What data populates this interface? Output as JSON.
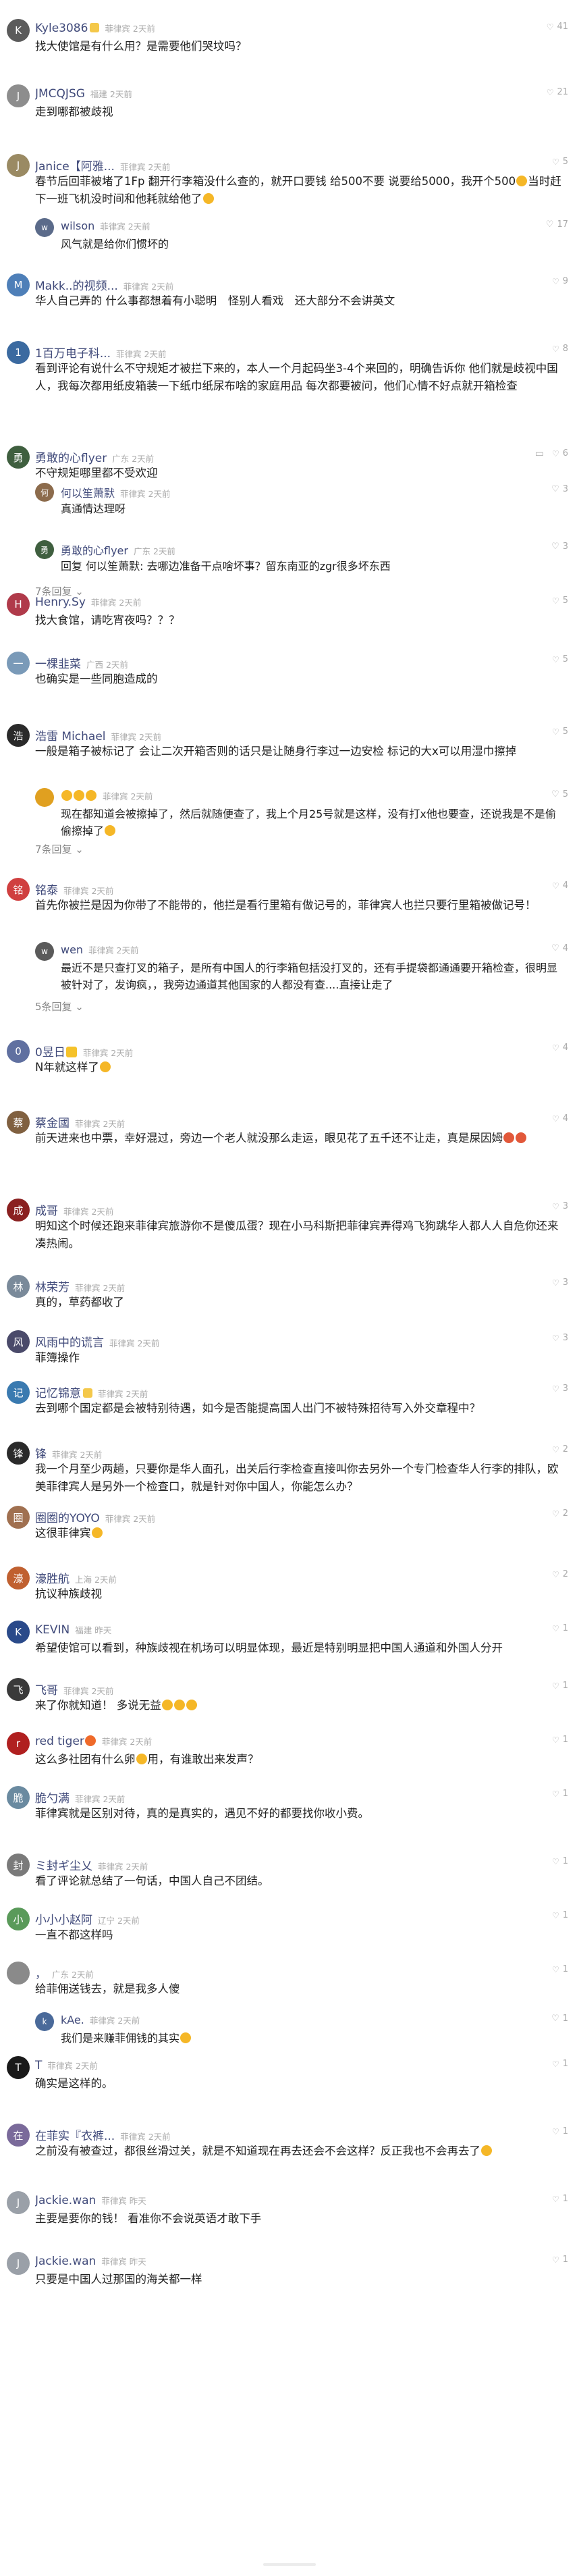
{
  "comments": [
    {
      "name": "Kyle3086",
      "badge": true,
      "meta": "菲律宾 2天前",
      "likes": "41",
      "text": "找大使馆是有什么用？是需要他们哭坟吗？",
      "color": "#5b5b5b",
      "replies": [],
      "more": ""
    },
    {
      "name": "JMCQJSG",
      "meta": "福建 2天前",
      "likes": "21",
      "text": "走到哪都被歧视",
      "color": "#8d8d8d",
      "replies": [],
      "more": ""
    },
    {
      "name": "Janice【阿雅...",
      "meta": "菲律宾 2天前",
      "likes": "5",
      "text": "春节后回菲被堵了1Fp 翻开行李箱没什么查的，就开口要钱 给500不要 说要给5000，我开个500😂当时赶下一班飞机没时间和他耗就给他了😂",
      "color": "#9a8a63",
      "replies": [
        {
          "name": "wilson",
          "meta": "菲律宾 2天前",
          "likes": "17",
          "text": "风气就是给你们惯坏的",
          "color": "#5b6b8a"
        }
      ],
      "more": ""
    },
    {
      "name": "Makk..的视频...",
      "meta": "菲律宾 2天前",
      "likes": "9",
      "text": "华人自己弄的 什么事都想着有小聪明　怪别人看戏　还大部分不会讲英文",
      "color": "#4e7fb8",
      "replies": [],
      "more": ""
    },
    {
      "name": "1百万电子科...",
      "meta": "菲律宾 2天前",
      "likes": "8",
      "text": "看到评论有说什么不守规矩才被拦下来的，本人一个月起码坐3-4个来回的，明确告诉你 他们就是歧视中国人，我每次都用纸皮箱装一下纸巾纸尿布啥的家庭用品 每次都要被问，他们心情不好点就开箱检查",
      "color": "#3b6aa0",
      "replies": [],
      "more": ""
    },
    {
      "name": "勇敢的心flyer",
      "meta": "广东 2天前",
      "likes": "6",
      "text": "不守规矩哪里都不受欢迎",
      "color": "#3f5f3f",
      "hasComment": true,
      "replies": [
        {
          "name": "何以笙萧默",
          "meta": "菲律宾 2天前",
          "likes": "3",
          "text": "真通情达理呀",
          "color": "#8c6b4c"
        },
        {
          "name": "勇敢的心flyer",
          "meta": "广东 2天前",
          "likes": "3",
          "text": "回复 何以笙萧默: 去哪边准备干点啥坏事？留东南亚的zgr很多坏东西",
          "color": "#3f5f3f"
        }
      ],
      "more": "7条回复"
    },
    {
      "name": "Henry.Sy",
      "meta": "菲律宾 2天前",
      "likes": "5",
      "text": "找大食馆，请吃宵夜吗？？？",
      "color": "#b03a4a",
      "replies": [],
      "more": ""
    },
    {
      "name": "一棵韭菜",
      "meta": "广西 2天前",
      "likes": "5",
      "text": "也确实是一些同胞造成的",
      "color": "#7a9ab8",
      "replies": [],
      "more": ""
    },
    {
      "name": "浩雷 Michael",
      "meta": "菲律宾 2天前",
      "likes": "5",
      "text": "一般是箱子被标记了 会让二次开箱否则的话只是让随身行李过一边安检 标记的大x可以用湿巾擦掉",
      "color": "#2a2a2a",
      "replies": [
        {
          "name": "😊😊😊",
          "meta": "菲律宾 2天前",
          "likes": "5",
          "text": "现在都知道会被擦掉了，然后就随便查了，我上个月25号就是这样，没有打x他也要查，还说我是不是偷偷擦掉了😂",
          "color": "#e0a020"
        }
      ],
      "more": "7条回复"
    },
    {
      "name": "铭泰",
      "meta": "菲律宾 2天前",
      "likes": "4",
      "text": "首先你被拦是因为你带了不能带的，他拦是看行里箱有做记号的，菲律宾人也拦只要行里箱被做记号！",
      "color": "#d04040",
      "replies": [
        {
          "name": "wen",
          "meta": "菲律宾 2天前",
          "likes": "4",
          "text": "最近不是只查打叉的箱子，是所有中国人的行李箱包括没打叉的，还有手提袋都通通要开箱检查，很明显被针对了，发询疯，，我旁边通道其他国家的人都没有查....直接让走了",
          "color": "#5a5a5a"
        }
      ],
      "more": "5条回复"
    },
    {
      "name": "0昱日💛",
      "meta": "菲律宾 2天前",
      "likes": "4",
      "text": "N年就这样了😏",
      "color": "#6070a0",
      "replies": [],
      "more": ""
    },
    {
      "name": "蔡金國",
      "meta": "菲律宾 2天前",
      "likes": "4",
      "text": "前天进来也中票，幸好混过，旁边一个老人就没那么走运，眼见花了五千还不让走，真是屎因姆😡😡",
      "color": "#806040",
      "replies": [],
      "more": ""
    },
    {
      "name": "成哥",
      "meta": "菲律宾 2天前",
      "likes": "3",
      "text": "明知这个时候还跑来菲律宾旅游你不是傻瓜蛋？现在小马科斯把菲律宾弄得鸡飞狗跳华人都人人自危你还来凑热闹。",
      "color": "#8a2020",
      "replies": [],
      "more": ""
    },
    {
      "name": "林荣芳",
      "meta": "菲律宾 2天前",
      "likes": "3",
      "text": "真的，草药都收了",
      "color": "#7a8a9a",
      "replies": [],
      "more": ""
    },
    {
      "name": "风雨中的谎言",
      "meta": "菲律宾 2天前",
      "likes": "3",
      "text": "菲簿操作",
      "color": "#4a4a6a",
      "replies": [],
      "more": ""
    },
    {
      "name": "记忆锦意",
      "badge": true,
      "meta": "菲律宾 2天前",
      "likes": "3",
      "text": "去到哪个国定都是会被特别待遇，如今是否能提高国人出门不被特殊招待写入外交章程中？",
      "color": "#3a7ab0",
      "replies": [],
      "more": ""
    },
    {
      "name": "锋",
      "meta": "菲律宾 2天前",
      "likes": "2",
      "text": "我一个月至少两趟，只要你是华人面孔，出关后行李检查直接叫你去另外一个专门检查华人行李的排队，欧美菲律宾人是另外一个检查口，就是针对你中国人，你能怎么办？",
      "color": "#2a2a2a",
      "replies": [],
      "more": ""
    },
    {
      "name": "圈圈的YOYO",
      "meta": "菲律宾 2天前",
      "likes": "2",
      "text": "这很菲律宾😂",
      "color": "#a07050",
      "replies": [],
      "more": ""
    },
    {
      "name": "濠胜航",
      "meta": "上海 2天前",
      "likes": "2",
      "text": "抗议种族歧视",
      "color": "#c06030",
      "replies": [],
      "more": ""
    },
    {
      "name": "KEVIN",
      "meta": "福建 昨天",
      "likes": "1",
      "text": "希望使馆可以看到，种族歧视在机场可以明显体现，最近是特别明显把中国人通道和外国人分开",
      "color": "#2a4a8a",
      "replies": [],
      "more": ""
    },
    {
      "name": "飞哥",
      "meta": "菲律宾 2天前",
      "likes": "1",
      "text": "来了你就知道！ 多说无益😂😂😂",
      "color": "#3a3a3a",
      "replies": [],
      "more": ""
    },
    {
      "name": "red tiger🔥",
      "meta": "菲律宾 2天前",
      "likes": "1",
      "text": "这么多社团有什么卵🐣用，有谁敢出来发声？",
      "color": "#b02020",
      "replies": [],
      "more": ""
    },
    {
      "name": "脆勺满",
      "meta": "菲律宾 2天前",
      "likes": "1",
      "text": "菲律宾就是区别对待，真的是真实的，遇见不好的都要找你收小费。",
      "color": "#6a8aa0",
      "replies": [],
      "more": ""
    },
    {
      "name": "ミ封ギ尘乂",
      "meta": "菲律宾 2天前",
      "likes": "1",
      "text": "看了评论就总结了一句话，中国人自己不团结。",
      "color": "#7a7a7a",
      "replies": [],
      "more": ""
    },
    {
      "name": "小小小赵阿",
      "meta": "辽宁 2天前",
      "likes": "1",
      "text": "一直不都这样吗",
      "color": "#5a9a5a",
      "replies": [],
      "more": ""
    },
    {
      "name": "，",
      "meta": "广东 2天前",
      "likes": "1",
      "text": "给菲佣送钱去，就是我多人傻",
      "color": "#8a8a8a",
      "replies": [
        {
          "name": "kAe.",
          "meta": "菲律宾 2天前",
          "likes": "1",
          "text": "我们是来赚菲佣钱的其实😂",
          "color": "#4a6a9a"
        }
      ],
      "more": ""
    },
    {
      "name": "T",
      "meta": "菲律宾 2天前",
      "likes": "1",
      "text": "确实是这样的。",
      "color": "#1a1a1a",
      "replies": [],
      "more": ""
    },
    {
      "name": "在菲实『衣裤...",
      "meta": "菲律宾 2天前",
      "likes": "1",
      "text": "之前没有被查过，都很丝滑过关，就是不知道现在再去还会不会这样？反正我也不会再去了😂",
      "color": "#7a6a9a",
      "replies": [],
      "more": ""
    },
    {
      "name": "Jackie.wan",
      "meta": "菲律宾 昨天",
      "likes": "1",
      "text": "主要是要你的钱！ 看准你不会说英语才敢下手",
      "color": "#9aa0a8",
      "replies": [],
      "more": ""
    },
    {
      "name": "Jackie.wan",
      "meta": "菲律宾 昨天",
      "likes": "1",
      "text": "只要是中国人过那国的海关都一样",
      "color": "#9aa0a8",
      "replies": [],
      "more": ""
    }
  ],
  "icons": {
    "like": "thumb-up-icon",
    "comment": "comment-icon"
  }
}
